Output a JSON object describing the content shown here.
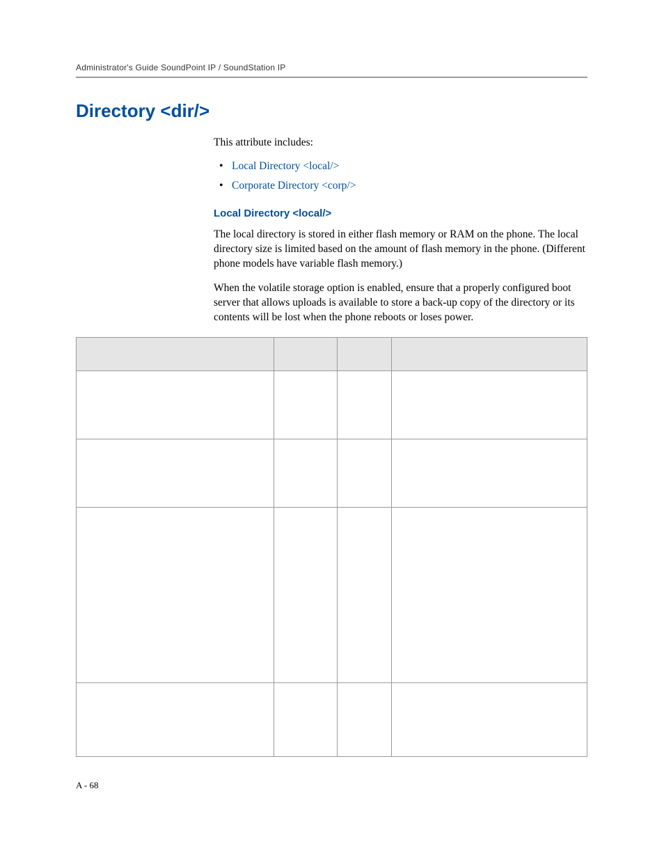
{
  "header": {
    "runningTitle": "Administrator's Guide SoundPoint IP / SoundStation IP"
  },
  "section": {
    "title": "Directory <dir/>",
    "intro": "This attribute includes:",
    "links": [
      "Local Directory <local/>",
      "Corporate Directory <corp/>"
    ],
    "sub": {
      "heading": "Local Directory <local/>",
      "para1": "The local directory is stored in either flash memory or RAM on the phone. The local directory size is limited based on the amount of flash memory in the phone. (Different phone models have variable flash memory.)",
      "para2": "When the volatile storage option is enabled, ensure that a properly configured boot server that allows uploads is available to store a back-up copy of the directory or its contents will be lost when the phone reboots or loses power."
    }
  },
  "pageNumber": "A - 68"
}
